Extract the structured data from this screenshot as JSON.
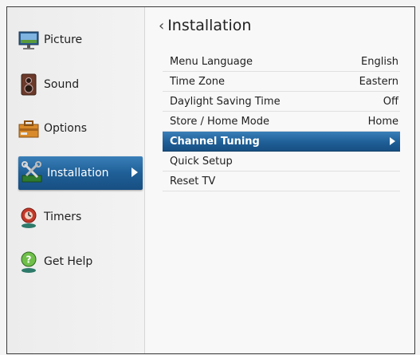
{
  "sidebar": {
    "items": [
      {
        "label": "Picture",
        "icon": "monitor-icon"
      },
      {
        "label": "Sound",
        "icon": "speaker-icon"
      },
      {
        "label": "Options",
        "icon": "toolbox-icon"
      },
      {
        "label": "Installation",
        "icon": "tools-icon",
        "selected": true
      },
      {
        "label": "Timers",
        "icon": "alarm-icon"
      },
      {
        "label": "Get Help",
        "icon": "help-icon"
      }
    ]
  },
  "main": {
    "title": "Installation",
    "rows": [
      {
        "label": "Menu Language",
        "value": "English"
      },
      {
        "label": "Time Zone",
        "value": "Eastern"
      },
      {
        "label": "Daylight Saving Time",
        "value": "Off"
      },
      {
        "label": "Store / Home Mode",
        "value": "Home"
      },
      {
        "label": "Channel Tuning",
        "value": "",
        "selected": true
      },
      {
        "label": "Quick Setup",
        "value": ""
      },
      {
        "label": "Reset TV",
        "value": ""
      }
    ]
  },
  "colors": {
    "selection_top": "#3a7fb8",
    "selection_bottom": "#174f82",
    "background": "#f6f6f6"
  }
}
